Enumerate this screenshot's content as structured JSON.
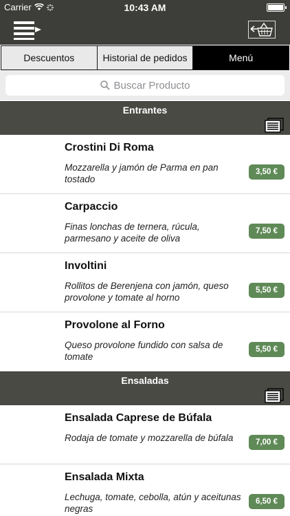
{
  "status_bar": {
    "carrier": "Carrier",
    "time": "10:43 AM"
  },
  "tabs": [
    {
      "label": "Descuentos",
      "active": false
    },
    {
      "label": "Historial de pedidos",
      "active": false
    },
    {
      "label": "Menú",
      "active": true
    }
  ],
  "search": {
    "placeholder": "Buscar Producto"
  },
  "sections": [
    {
      "title": "Entrantes",
      "items": [
        {
          "name": "Crostini Di Roma",
          "description": "Mozzarella y jamón de Parma en pan tostado",
          "price": "3,50 €"
        },
        {
          "name": "Carpaccio",
          "description": "Finas lonchas de ternera, rúcula, parmesano y aceite de oliva",
          "price": "7,50 €"
        },
        {
          "name": "Involtini",
          "description": "Rollitos de Berenjena con jamón, queso provolone y tomate al horno",
          "price": "5,50 €"
        },
        {
          "name": "Provolone al Forno",
          "description": "Queso provolone fundido con salsa de tomate",
          "price": "5,50 €"
        }
      ]
    },
    {
      "title": "Ensaladas",
      "items": [
        {
          "name": "Ensalada Caprese de Búfala",
          "description": "Rodaja de tomate y mozzarella de búfala",
          "price": "7,00 €"
        },
        {
          "name": "Ensalada Mixta",
          "description": "Lechuga, tomate, cebolla, atún y aceitunas negras",
          "price": "6,50 €"
        }
      ]
    }
  ],
  "colors": {
    "nav_bg": "#3d3d3a",
    "section_bg": "#4a4a45",
    "price_bg": "#5f8a57",
    "active_tab": "#000000"
  },
  "icons": {
    "menu": "menu-arrow-icon",
    "cart": "basket-icon",
    "search": "search-icon",
    "section": "list-icon"
  }
}
